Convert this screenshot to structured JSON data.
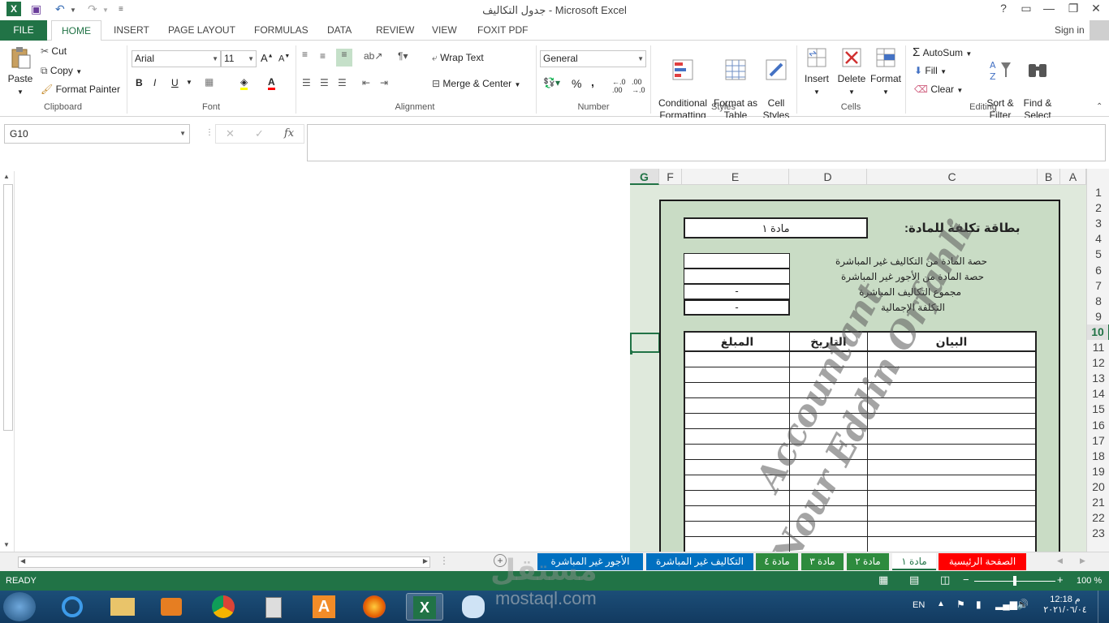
{
  "window": {
    "title": "جدول التكاليف - Microsoft Excel",
    "help": "?",
    "restore": "▭",
    "minimize": "—",
    "maximize": "❐",
    "close": "✕"
  },
  "account": {
    "sign_in": "Sign in"
  },
  "tabs": [
    "FILE",
    "HOME",
    "INSERT",
    "PAGE LAYOUT",
    "FORMULAS",
    "DATA",
    "REVIEW",
    "VIEW",
    "FOXIT PDF"
  ],
  "ribbon": {
    "clipboard": {
      "paste": "Paste",
      "cut": "Cut",
      "copy": "Copy",
      "format_painter": "Format Painter",
      "label": "Clipboard"
    },
    "font": {
      "name": "Arial",
      "size": "11",
      "bold": "B",
      "italic": "I",
      "underline": "U",
      "label": "Font"
    },
    "alignment": {
      "wrap_text": "Wrap Text",
      "merge_center": "Merge & Center",
      "label": "Alignment"
    },
    "number": {
      "format": "General",
      "percent": "%",
      "comma": ",",
      "label": "Number"
    },
    "styles": {
      "conditional": "Conditional\nFormatting",
      "format_table": "Format as\nTable",
      "cell_styles": "Cell\nStyles",
      "label": "Styles"
    },
    "cells": {
      "insert": "Insert",
      "delete": "Delete",
      "format": "Format",
      "label": "Cells"
    },
    "editing": {
      "autosum": "AutoSum",
      "fill": "Fill",
      "clear": "Clear",
      "sort_filter": "Sort &\nFilter",
      "find_select": "Find &\nSelect",
      "label": "Editing"
    }
  },
  "formula_bar": {
    "name_box": "G10",
    "fx": "fx",
    "cancel": "✕",
    "enter": "✓",
    "value": ""
  },
  "columns": [
    "G",
    "F",
    "E",
    "D",
    "C",
    "B",
    "A"
  ],
  "rows": [
    "1",
    "2",
    "3",
    "4",
    "5",
    "6",
    "7",
    "8",
    "9",
    "10",
    "11",
    "12",
    "13",
    "14",
    "15",
    "16",
    "17",
    "18",
    "19",
    "20",
    "21",
    "22",
    "23"
  ],
  "card": {
    "title": "بطاقة تكلفة للمادة:",
    "material": "مادة ١",
    "labels": [
      "حصة المادة من التكاليف غير المباشرة",
      "حصة المادة من الأجور غير المباشرة",
      "مجموع التكاليف المباشرة",
      "التكلفة الإجمالية"
    ],
    "values": [
      "",
      "",
      "-",
      "-"
    ],
    "table_headers": {
      "amount": "المبلغ",
      "date": "التاريخ",
      "statement": "البيان"
    }
  },
  "watermark": [
    "Accountant",
    "Nour Eddin Orfahli"
  ],
  "sheet_tabs": [
    {
      "label": "الصفحة الرئيسية",
      "color": "#ff0000"
    },
    {
      "label": "مادة ١",
      "color": "#ffffff"
    },
    {
      "label": "مادة ٢",
      "color": "#2e8b3e"
    },
    {
      "label": "مادة ٣",
      "color": "#2e8b3e"
    },
    {
      "label": "مادة ٤",
      "color": "#2e8b3e"
    },
    {
      "label": "التكاليف غير المباشرة",
      "color": "#0070c0"
    },
    {
      "label": "الأجور غير المباشرة",
      "color": "#0070c0"
    }
  ],
  "status": {
    "ready": "READY",
    "zoom": "100 %"
  },
  "overlay": {
    "brand": "مستقل",
    "site": "mostaql.com"
  },
  "taskbar": {
    "lang": "EN",
    "time": "12:18 م",
    "date": "٢٠٢١/٠٦/٠٤"
  }
}
